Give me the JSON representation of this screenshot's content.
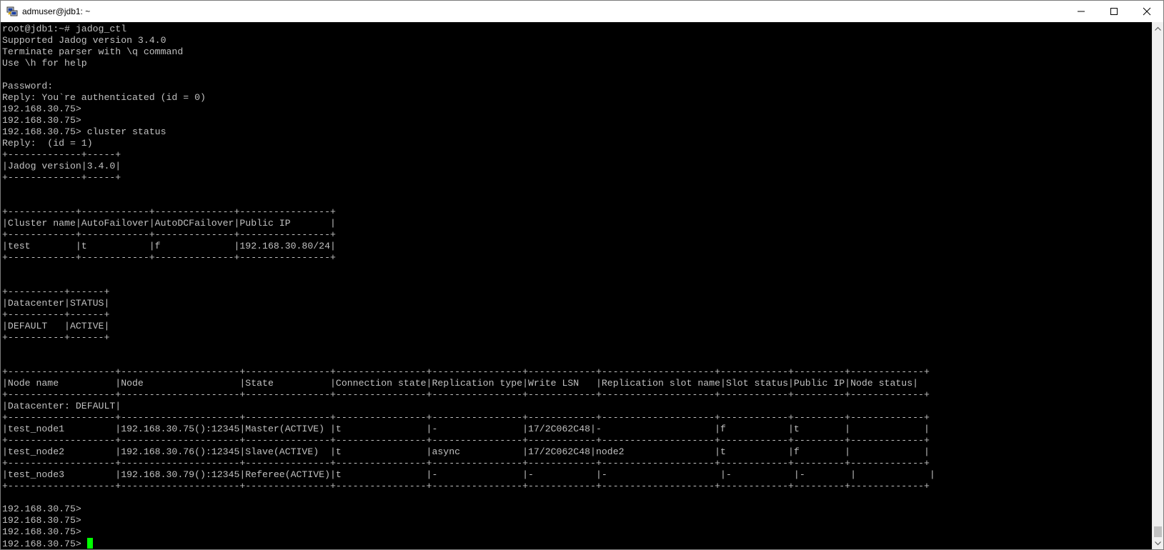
{
  "window": {
    "title": "admuser@jdb1: ~"
  },
  "icons": {
    "app": "putty-icon",
    "minimize": "minimize-icon",
    "maximize": "maximize-icon",
    "close": "close-icon",
    "scroll_up": "chevron-up-icon",
    "scroll_down": "chevron-down-icon"
  },
  "terminal": {
    "lines": [
      "root@jdb1:~# jadog_ctl",
      "Supported Jadog version 3.4.0",
      "Terminate parser with \\q command",
      "Use \\h for help",
      "",
      "Password:",
      "Reply: You`re authenticated (id = 0)",
      "192.168.30.75>",
      "192.168.30.75>",
      "192.168.30.75> cluster status",
      "Reply:  (id = 1)",
      "+-------------+-----+",
      "|Jadog version|3.4.0|",
      "+-------------+-----+",
      "",
      "",
      "+------------+------------+--------------+----------------+",
      "|Cluster name|AutoFailover|AutoDCFailover|Public IP       |",
      "+------------+------------+--------------+----------------+",
      "|test        |t           |f             |192.168.30.80/24|",
      "+------------+------------+--------------+----------------+",
      "",
      "",
      "+----------+------+",
      "|Datacenter|STATUS|",
      "+----------+------+",
      "|DEFAULT   |ACTIVE|",
      "+----------+------+",
      "",
      "",
      "+-------------------+---------------------+---------------+----------------+----------------+------------+--------------------+------------+---------+-------------+",
      "|Node name          |Node                 |State          |Connection state|Replication type|Write LSN   |Replication slot name|Slot status|Public IP|Node status|",
      "+-------------------+---------------------+---------------+----------------+----------------+------------+--------------------+------------+---------+-------------+",
      "|Datacenter: DEFAULT|",
      "+-------------------+---------------------+---------------+----------------+----------------+------------+--------------------+------------+---------+-------------+",
      "|test_node1         |192.168.30.75():12345|Master(ACTIVE) |t               |-               |17/2C062C48|-                    |f           |t        |             |",
      "+-------------------+---------------------+---------------+----------------+----------------+------------+--------------------+------------+---------+-------------+",
      "|test_node2         |192.168.30.76():12345|Slave(ACTIVE)  |t               |async           |17/2C062C48|node2                |t           |f        |             |",
      "+-------------------+---------------------+---------------+----------------+----------------+------------+--------------------+------------+---------+-------------+",
      "|test_node3         |192.168.30.79():12345|Referee(ACTIVE)|t               |-               |-           |-                    |-           |-        |             |",
      "+-------------------+---------------------+---------------+----------------+----------------+------------+--------------------+------------+---------+-------------+",
      "",
      "192.168.30.75>",
      "192.168.30.75>",
      "192.168.30.75>",
      "192.168.30.75> "
    ]
  },
  "colors": {
    "terminal_bg": "#000000",
    "terminal_fg": "#c0c0c0",
    "cursor": "#00ff00"
  }
}
